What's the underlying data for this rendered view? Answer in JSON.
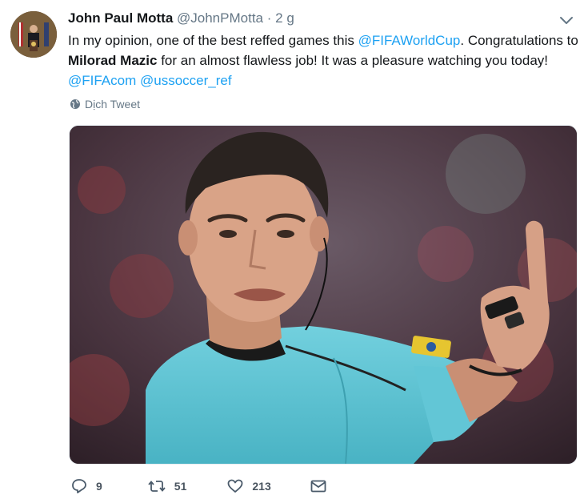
{
  "tweet": {
    "display_name": "John Paul Motta",
    "handle": "@JohnPMotta",
    "separator": "·",
    "time": "2 g",
    "text_1": "In my opinion, one of the best reffed games this ",
    "mention_1": "@FIFAWorldCup",
    "text_2": ". Congratulations to ",
    "bold_name": "Milorad Mazic",
    "text_3": " for an almost flawless job!  It was a pleasure watching you today! ",
    "mention_2": "@FIFAcom",
    "text_4": " ",
    "mention_3": "@ussoccer_ref",
    "translate_label": "Dịch Tweet"
  },
  "actions": {
    "reply_count": "9",
    "retweet_count": "51",
    "like_count": "213"
  },
  "colors": {
    "link": "#1da1f2",
    "muted": "#657786",
    "jersey": "#5cc4d4"
  }
}
